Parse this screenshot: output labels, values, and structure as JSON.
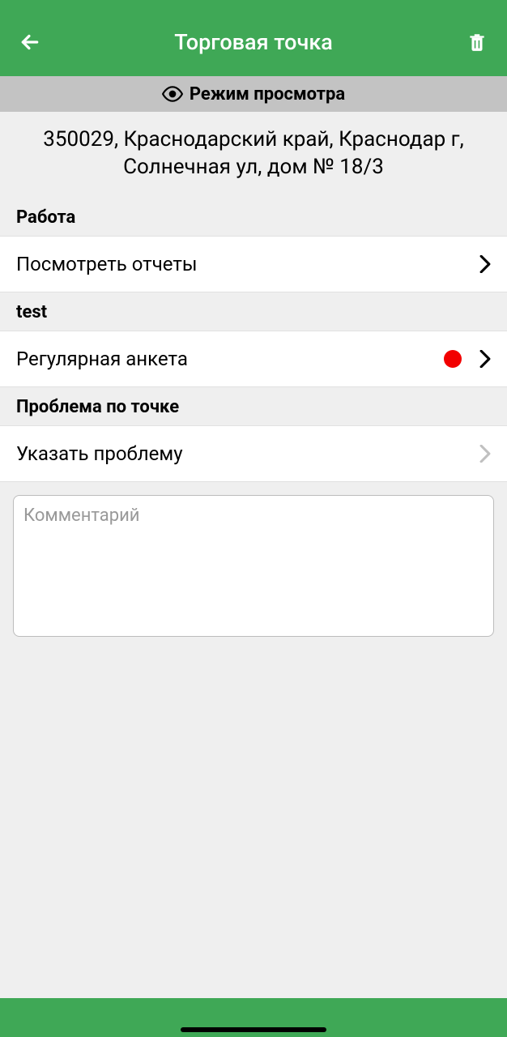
{
  "header": {
    "title": "Торговая точка"
  },
  "viewMode": {
    "label": "Режим просмотра"
  },
  "address": "350029, Краснодарский край, Краснодар г, Солнечная ул, дом № 18/3",
  "sections": {
    "work": {
      "header": "Работа",
      "item": "Посмотреть отчеты"
    },
    "test": {
      "header": "test",
      "item": "Регулярная анкета"
    },
    "problem": {
      "header": "Проблема по точке",
      "item": "Указать проблему"
    }
  },
  "comment": {
    "placeholder": "Комментарий",
    "value": ""
  }
}
